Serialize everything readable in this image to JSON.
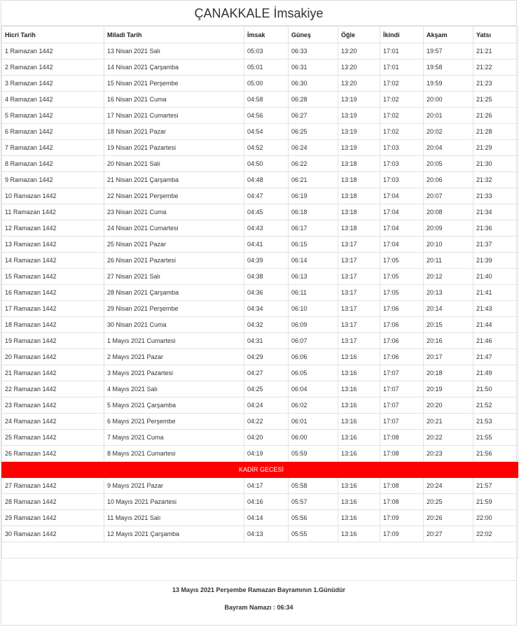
{
  "title": "ÇANAKKALE İmsakiye",
  "columns": [
    "Hicri Tarih",
    "Miladi Tarih",
    "İmsak",
    "Güneş",
    "Öğle",
    "İkindi",
    "Akşam",
    "Yatsı"
  ],
  "rows_before": [
    [
      "1 Ramazan 1442",
      "13 Nisan 2021 Salı",
      "05:03",
      "06:33",
      "13:20",
      "17:01",
      "19:57",
      "21:21"
    ],
    [
      "2 Ramazan 1442",
      "14 Nisan 2021 Çarşamba",
      "05:01",
      "06:31",
      "13:20",
      "17:01",
      "19:58",
      "21:22"
    ],
    [
      "3 Ramazan 1442",
      "15 Nisan 2021 Perşembe",
      "05:00",
      "06:30",
      "13:20",
      "17:02",
      "19:59",
      "21:23"
    ],
    [
      "4 Ramazan 1442",
      "16 Nisan 2021 Cuma",
      "04:58",
      "06:28",
      "13:19",
      "17:02",
      "20:00",
      "21:25"
    ],
    [
      "5 Ramazan 1442",
      "17 Nisan 2021 Cumartesi",
      "04:56",
      "06:27",
      "13:19",
      "17:02",
      "20:01",
      "21:26"
    ],
    [
      "6 Ramazan 1442",
      "18 Nisan 2021 Pazar",
      "04:54",
      "06:25",
      "13:19",
      "17:02",
      "20:02",
      "21:28"
    ],
    [
      "7 Ramazan 1442",
      "19 Nisan 2021 Pazartesi",
      "04:52",
      "06:24",
      "13:19",
      "17:03",
      "20:04",
      "21:29"
    ],
    [
      "8 Ramazan 1442",
      "20 Nisan 2021 Salı",
      "04:50",
      "06:22",
      "13:18",
      "17:03",
      "20:05",
      "21:30"
    ],
    [
      "9 Ramazan 1442",
      "21 Nisan 2021 Çarşamba",
      "04:48",
      "06:21",
      "13:18",
      "17:03",
      "20:06",
      "21:32"
    ],
    [
      "10 Ramazan 1442",
      "22 Nisan 2021 Perşembe",
      "04:47",
      "06:19",
      "13:18",
      "17:04",
      "20:07",
      "21:33"
    ],
    [
      "11 Ramazan 1442",
      "23 Nisan 2021 Cuma",
      "04:45",
      "06:18",
      "13:18",
      "17:04",
      "20:08",
      "21:34"
    ],
    [
      "12 Ramazan 1442",
      "24 Nisan 2021 Cumartesi",
      "04:43",
      "06:17",
      "13:18",
      "17:04",
      "20:09",
      "21:36"
    ],
    [
      "13 Ramazan 1442",
      "25 Nisan 2021 Pazar",
      "04:41",
      "06:15",
      "13:17",
      "17:04",
      "20:10",
      "21:37"
    ],
    [
      "14 Ramazan 1442",
      "26 Nisan 2021 Pazartesi",
      "04:39",
      "06:14",
      "13:17",
      "17:05",
      "20:11",
      "21:39"
    ],
    [
      "15 Ramazan 1442",
      "27 Nisan 2021 Salı",
      "04:38",
      "06:13",
      "13:17",
      "17:05",
      "20:12",
      "21:40"
    ],
    [
      "16 Ramazan 1442",
      "28 Nisan 2021 Çarşamba",
      "04:36",
      "06:11",
      "13:17",
      "17:05",
      "20:13",
      "21:41"
    ],
    [
      "17 Ramazan 1442",
      "29 Nisan 2021 Perşembe",
      "04:34",
      "06:10",
      "13:17",
      "17:06",
      "20:14",
      "21:43"
    ],
    [
      "18 Ramazan 1442",
      "30 Nisan 2021 Cuma",
      "04:32",
      "06:09",
      "13:17",
      "17:06",
      "20:15",
      "21:44"
    ],
    [
      "19 Ramazan 1442",
      "1 Mayıs 2021 Cumartesi",
      "04:31",
      "06:07",
      "13:17",
      "17:06",
      "20:16",
      "21:46"
    ],
    [
      "20 Ramazan 1442",
      "2 Mayıs 2021 Pazar",
      "04:29",
      "06:06",
      "13:16",
      "17:06",
      "20:17",
      "21:47"
    ],
    [
      "21 Ramazan 1442",
      "3 Mayıs 2021 Pazartesi",
      "04:27",
      "06:05",
      "13:16",
      "17:07",
      "20:18",
      "21:49"
    ],
    [
      "22 Ramazan 1442",
      "4 Mayıs 2021 Salı",
      "04:25",
      "06:04",
      "13:16",
      "17:07",
      "20:19",
      "21:50"
    ],
    [
      "23 Ramazan 1442",
      "5 Mayıs 2021 Çarşamba",
      "04:24",
      "06:02",
      "13:16",
      "17:07",
      "20:20",
      "21:52"
    ],
    [
      "24 Ramazan 1442",
      "6 Mayıs 2021 Perşembe",
      "04:22",
      "06:01",
      "13:16",
      "17:07",
      "20:21",
      "21:53"
    ],
    [
      "25 Ramazan 1442",
      "7 Mayıs 2021 Cuma",
      "04:20",
      "06:00",
      "13:16",
      "17:08",
      "20:22",
      "21:55"
    ],
    [
      "26 Ramazan 1442",
      "8 Mayıs 2021 Cumartesi",
      "04:19",
      "05:59",
      "13:16",
      "17:08",
      "20:23",
      "21:56"
    ]
  ],
  "kadir_label": "KADİR GECESİ",
  "kadir_color": "#ff0000",
  "rows_after": [
    [
      "27 Ramazan 1442",
      "9 Mayıs 2021 Pazar",
      "04:17",
      "05:58",
      "13:16",
      "17:08",
      "20:24",
      "21:57"
    ],
    [
      "28 Ramazan 1442",
      "10 Mayıs 2021 Pazartesi",
      "04:16",
      "05:57",
      "13:16",
      "17:08",
      "20:25",
      "21:59"
    ],
    [
      "29 Ramazan 1442",
      "11 Mayıs 2021 Salı",
      "04:14",
      "05:56",
      "13:16",
      "17:09",
      "20:26",
      "22:00"
    ],
    [
      "30 Ramazan 1442",
      "12 Mayıs 2021 Çarşamba",
      "04:13",
      "05:55",
      "13:16",
      "17:09",
      "20:27",
      "22:02"
    ]
  ],
  "footer": {
    "bayram_note": "13 Mayıs 2021 Perşembe Ramazan Bayramının 1.Günüdür",
    "bayram_namazi": "Bayram Namazı : 06:34"
  }
}
